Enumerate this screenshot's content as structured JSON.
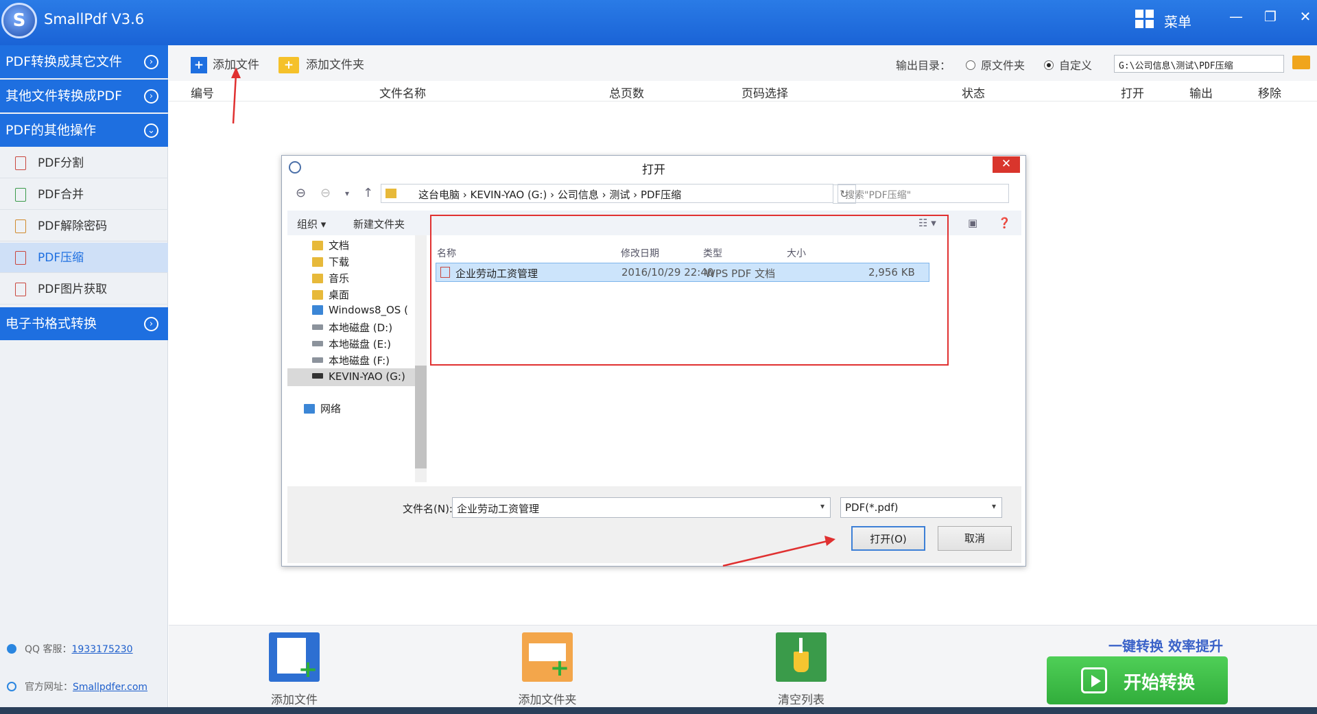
{
  "app": {
    "title": "SmallPdf V3.6",
    "logo": "S",
    "menu_label": "菜单",
    "minimize": "—",
    "restore": "❐",
    "close": "✕"
  },
  "sidebar": {
    "categories": [
      {
        "label": "PDF转换成其它文件",
        "icon": "›"
      },
      {
        "label": "其他文件转换成PDF",
        "icon": "›"
      },
      {
        "label": "PDF的其他操作",
        "icon": "⌄"
      },
      {
        "label": "电子书格式转换",
        "icon": "›"
      }
    ],
    "items": [
      {
        "label": "PDF分割"
      },
      {
        "label": "PDF合并"
      },
      {
        "label": "PDF解除密码"
      },
      {
        "label": "PDF压缩",
        "active": true
      },
      {
        "label": "PDF图片获取"
      }
    ],
    "support": {
      "qq_label": "QQ 客服：",
      "qq_value": "1933175230",
      "site_label": "官方网址：",
      "site_value": "Smallpdfer.com"
    }
  },
  "toolbar": {
    "add_file": "添加文件",
    "add_folder": "添加文件夹",
    "output_label": "输出目录：",
    "radio_original": "原文件夹",
    "radio_custom": "自定义",
    "output_path": "G:\\公司信息\\测试\\PDF压缩"
  },
  "table_headers": [
    "编号",
    "文件名称",
    "总页数",
    "页码选择",
    "状态",
    "打开",
    "输出",
    "移除"
  ],
  "bottom": {
    "add_file": "添加文件",
    "add_folder": "添加文件夹",
    "clear_list": "清空列表",
    "slogan": "一键转换  效率提升",
    "start": "开始转换"
  },
  "dialog": {
    "title": "打开",
    "close": "✕",
    "breadcrumb": [
      "这台电脑",
      "KEVIN-YAO (G:)",
      "公司信息",
      "测试",
      "PDF压缩"
    ],
    "breadcrumb_text": "这台电脑  ›  KEVIN-YAO (G:)  ›  公司信息  ›  测试  ›  PDF压缩",
    "search_placeholder": "搜索\"PDF压缩\"",
    "organize": "组织 ▾",
    "new_folder": "新建文件夹",
    "tree": [
      "文档",
      "下载",
      "音乐",
      "桌面",
      "Windows8_OS (",
      "本地磁盘 (D:)",
      "本地磁盘 (E:)",
      "本地磁盘 (F:)",
      "KEVIN-YAO (G:)",
      "网络"
    ],
    "columns": [
      "名称",
      "修改日期",
      "类型",
      "大小"
    ],
    "file": {
      "name": "企业劳动工资管理",
      "date": "2016/10/29 22:40",
      "type": "WPS PDF 文档",
      "size": "2,956 KB"
    },
    "filename_label": "文件名(N):",
    "filename_value": "企业劳动工资管理",
    "filter": "PDF(*.pdf)",
    "open_btn": "打开(O)",
    "cancel_btn": "取消"
  },
  "colors": {
    "accent": "#1e6fe0",
    "start": "#3dbb45",
    "annotation": "#e03030"
  }
}
